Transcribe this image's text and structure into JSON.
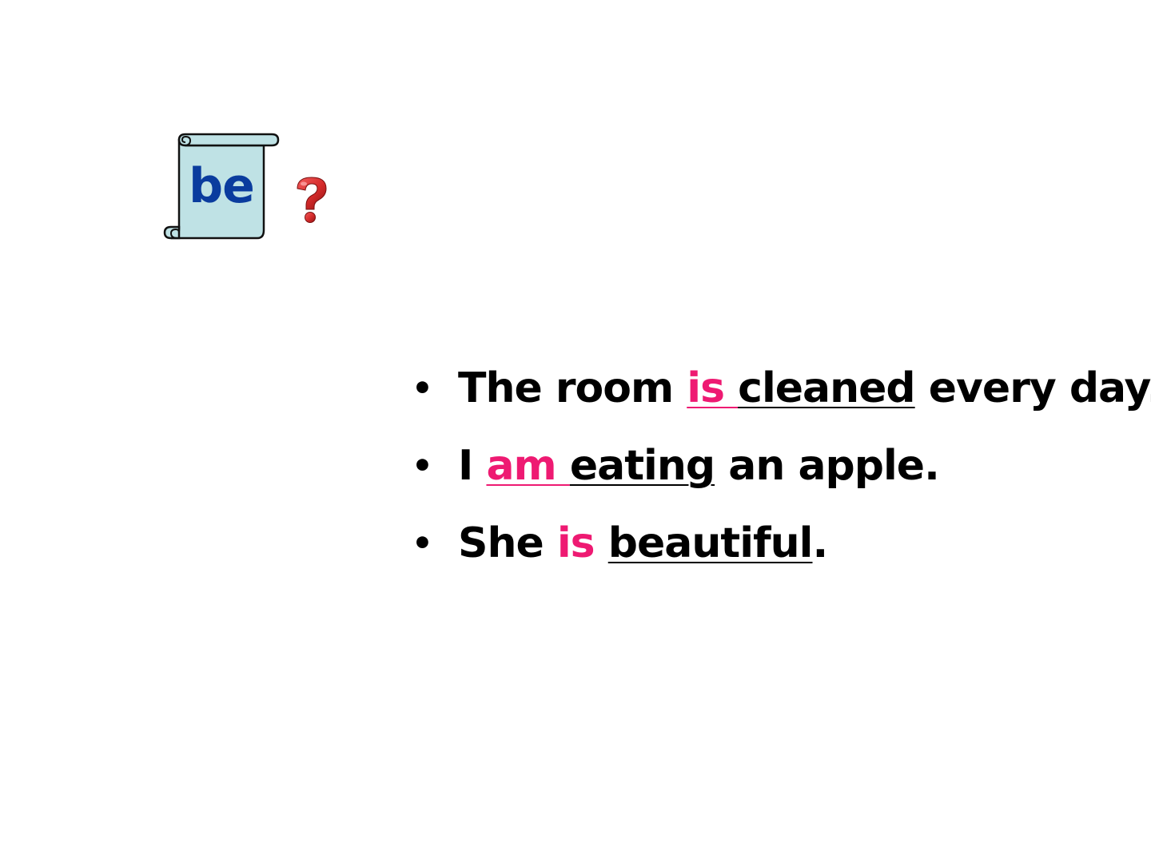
{
  "scroll": {
    "word": "be",
    "icon": "scroll-icon"
  },
  "question_icon": "question-mark-icon",
  "colors": {
    "auxiliary": "#ee1a72",
    "scroll_text": "#0a3c9e",
    "scroll_fill": "#bfe2e5",
    "question_mark": "#d42a2a"
  },
  "sentences": [
    {
      "bullet": "•",
      "before": "The room ",
      "aux": "is ",
      "target": "cleaned",
      "after": " every day."
    },
    {
      "bullet": "•",
      "before": "I ",
      "aux": "am ",
      "target": "eating",
      "after": " an apple."
    },
    {
      "bullet": "•",
      "before": "She ",
      "aux": "is",
      "gap": " ",
      "target": "beautiful",
      "after": "."
    }
  ]
}
